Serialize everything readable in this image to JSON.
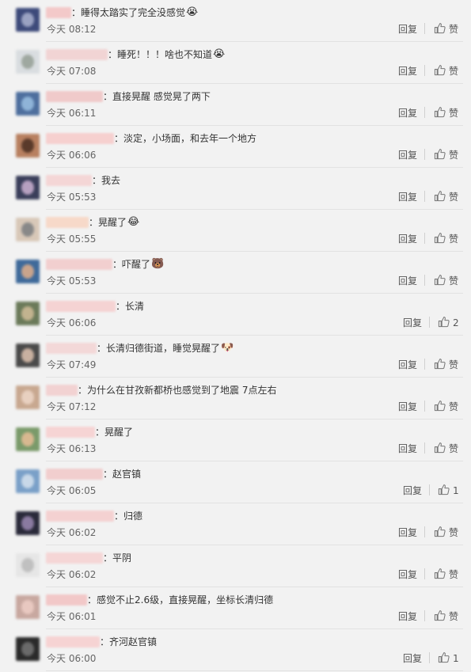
{
  "reply_label": "回复",
  "colors": {
    "background": "#f2f2f2",
    "text": "#333333",
    "time": "#666666",
    "divider": "#e2e2e2"
  },
  "comments": [
    {
      "content": "睡得太踏实了完全没感觉",
      "emoji": "😭",
      "time": "今天 08:12",
      "like": "赞"
    },
    {
      "content": "睡死！！！啥也不知道",
      "emoji": "😭",
      "time": "今天 07:08",
      "like": "赞"
    },
    {
      "content": "直接晃醒 感觉晃了两下",
      "emoji": "",
      "time": "今天 06:11",
      "like": "赞"
    },
    {
      "content": "淡定，小场面，和去年一个地方",
      "emoji": "",
      "time": "今天 06:06",
      "like": "赞"
    },
    {
      "content": "我去",
      "emoji": "",
      "time": "今天 05:53",
      "like": "赞"
    },
    {
      "content": "晃醒了",
      "emoji": "😂",
      "time": "今天 05:55",
      "like": "赞"
    },
    {
      "content": "吓醒了",
      "emoji": "🐻",
      "time": "今天 05:53",
      "like": "赞"
    },
    {
      "content": "长清",
      "emoji": "",
      "time": "今天 06:06",
      "like": "2"
    },
    {
      "content": "长清归德街道，睡觉晃醒了",
      "emoji": "🐶",
      "time": "今天 07:49",
      "like": "赞"
    },
    {
      "content": "为什么在甘孜新都桥也感觉到了地震 7点左右",
      "emoji": "",
      "time": "今天 07:12",
      "like": "赞"
    },
    {
      "content": "晃醒了",
      "emoji": "",
      "time": "今天 06:13",
      "like": "赞"
    },
    {
      "content": "赵官镇",
      "emoji": "",
      "time": "今天 06:05",
      "like": "1"
    },
    {
      "content": "归德",
      "emoji": "",
      "time": "今天 06:02",
      "like": "赞"
    },
    {
      "content": "平阴",
      "emoji": "",
      "time": "今天 06:02",
      "like": "赞"
    },
    {
      "content": "感觉不止2.6级，直接晃醒，坐标长清归德",
      "emoji": "",
      "time": "今天 06:01",
      "like": "赞"
    },
    {
      "content": "齐河赵官镇",
      "emoji": "",
      "time": "今天 06:00",
      "like": "1"
    }
  ]
}
